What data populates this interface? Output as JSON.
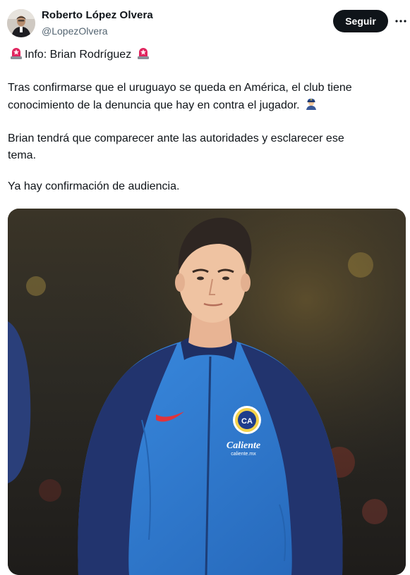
{
  "author": {
    "display_name": "Roberto López Olvera",
    "handle": "@LopezOlvera",
    "follow_label": "Seguir"
  },
  "tweet": {
    "headline": "Info: Brian Rodríguez",
    "paragraph1_line1": "Tras confirmarse que el uruguayo se queda en América, el club tiene",
    "paragraph1_line2": "conocimiento de la denuncia que hay en contra el jugador.",
    "paragraph2_line1": "Brian tendrá que comparecer ante las autoridades y esclarecer ese",
    "paragraph2_line2": "tema.",
    "paragraph3": "Ya hay confirmación de audiencia."
  },
  "icons": {
    "headline_left": "police-light-icon",
    "headline_right": "police-light-icon",
    "after_paragraph1": "police-officer-icon",
    "more": "more-options-icon"
  },
  "media": {
    "jersey_logo_text": "Caliente",
    "jersey_logo_subtext": "caliente.mx",
    "crest_text": "CA"
  },
  "colors": {
    "follow_button_bg": "#0f1419",
    "handle_text": "#536471",
    "jersey_blue": "#2f7fd1",
    "jersey_navy": "#1f2f63"
  }
}
